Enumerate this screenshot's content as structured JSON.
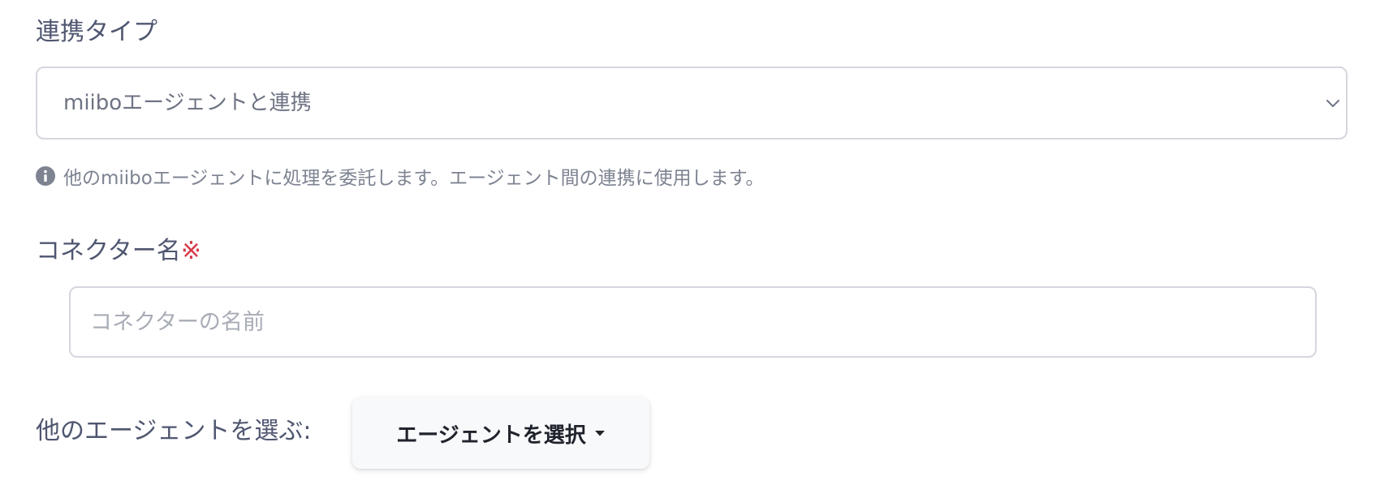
{
  "integration_type": {
    "label": "連携タイプ",
    "selected": "miiboエージェントと連携",
    "help_text": "他のmiiboエージェントに処理を委託します。エージェント間の連携に使用します。"
  },
  "connector_name": {
    "label": "コネクター名",
    "required_mark": "※",
    "placeholder": "コネクターの名前",
    "value": ""
  },
  "agent_select": {
    "label": "他のエージェントを選ぶ:",
    "button_label": "エージェントを選択"
  },
  "colors": {
    "label_text": "#4f5670",
    "required": "#d63a4a",
    "border": "#d4d7dd",
    "button_bg": "#f8f9fb"
  },
  "icons": {
    "help": "info-circle-icon",
    "select": "chevron-down-icon",
    "button": "caret-down-icon"
  }
}
